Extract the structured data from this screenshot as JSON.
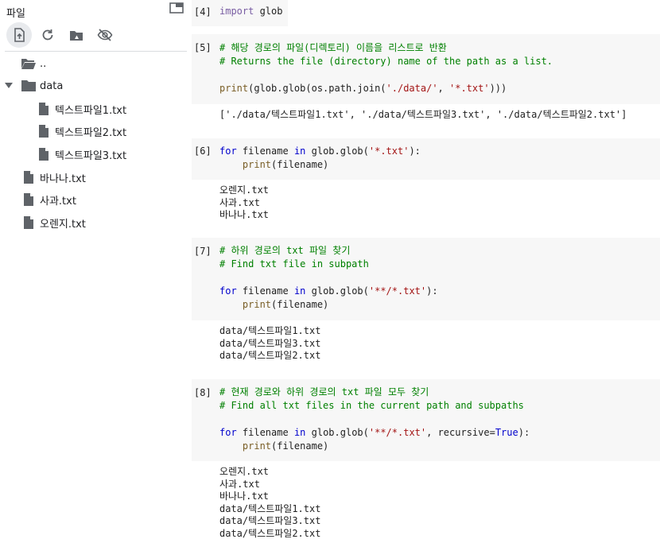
{
  "sidebar": {
    "title": "파일",
    "toolbar": [
      "upload-icon",
      "refresh-icon",
      "drive-icon",
      "visibility-off-icon"
    ],
    "tree": {
      "parent": "..",
      "folder": "data",
      "data_files": [
        "텍스트파일1.txt",
        "텍스트파일2.txt",
        "텍스트파일3.txt"
      ],
      "root_files": [
        "바나나.txt",
        "사과.txt",
        "오렌지.txt"
      ]
    }
  },
  "cells": {
    "c4": {
      "prompt": "[4]",
      "kw": "import",
      "rest": " glob"
    },
    "c5": {
      "prompt": "[5]",
      "comment1": "# 해당 경로의 파일(디렉토리) 이름을 리스트로 반환",
      "comment2": "# Returns the file (directory) name of the path as a list.",
      "fn": "print",
      "mid": "(glob.glob(os.path.join(",
      "s1": "'./data/'",
      "sep": ", ",
      "s2": "'*.txt'",
      "end": ")))",
      "output": "['./data/텍스트파일1.txt', './data/텍스트파일3.txt', './data/텍스트파일2.txt']"
    },
    "c6": {
      "prompt": "[6]",
      "for": "for",
      "var": " filename ",
      "in": "in",
      "call": " glob.glob(",
      "str": "'*.txt'",
      "close": "):",
      "indent": "    ",
      "fn": "print",
      "arg": "(filename)",
      "output": [
        "오렌지.txt",
        "사과.txt",
        "바나나.txt"
      ]
    },
    "c7": {
      "prompt": "[7]",
      "comment1": "# 하위 경로의 txt 파일 찾기",
      "comment2": "# Find txt file in subpath",
      "for": "for",
      "var": " filename ",
      "in": "in",
      "call": " glob.glob(",
      "str": "'**/*.txt'",
      "close": "):",
      "indent": "    ",
      "fn": "print",
      "arg": "(filename)",
      "output": [
        "data/텍스트파일1.txt",
        "data/텍스트파일3.txt",
        "data/텍스트파일2.txt"
      ]
    },
    "c8": {
      "prompt": "[8]",
      "comment1": "# 현재 경로와 하위 경로의 txt 파일 모두 찾기",
      "comment2": "# Find all txt files in the current path and subpaths",
      "for": "for",
      "var": " filename ",
      "in": "in",
      "call": " glob.glob(",
      "str": "'**/*.txt'",
      "kwarg": ", recursive=",
      "true": "True",
      "close": "):",
      "indent": "    ",
      "fn": "print",
      "arg": "(filename)",
      "output": [
        "오렌지.txt",
        "사과.txt",
        "바나나.txt",
        "data/텍스트파일1.txt",
        "data/텍스트파일3.txt",
        "data/텍스트파일2.txt"
      ]
    }
  }
}
